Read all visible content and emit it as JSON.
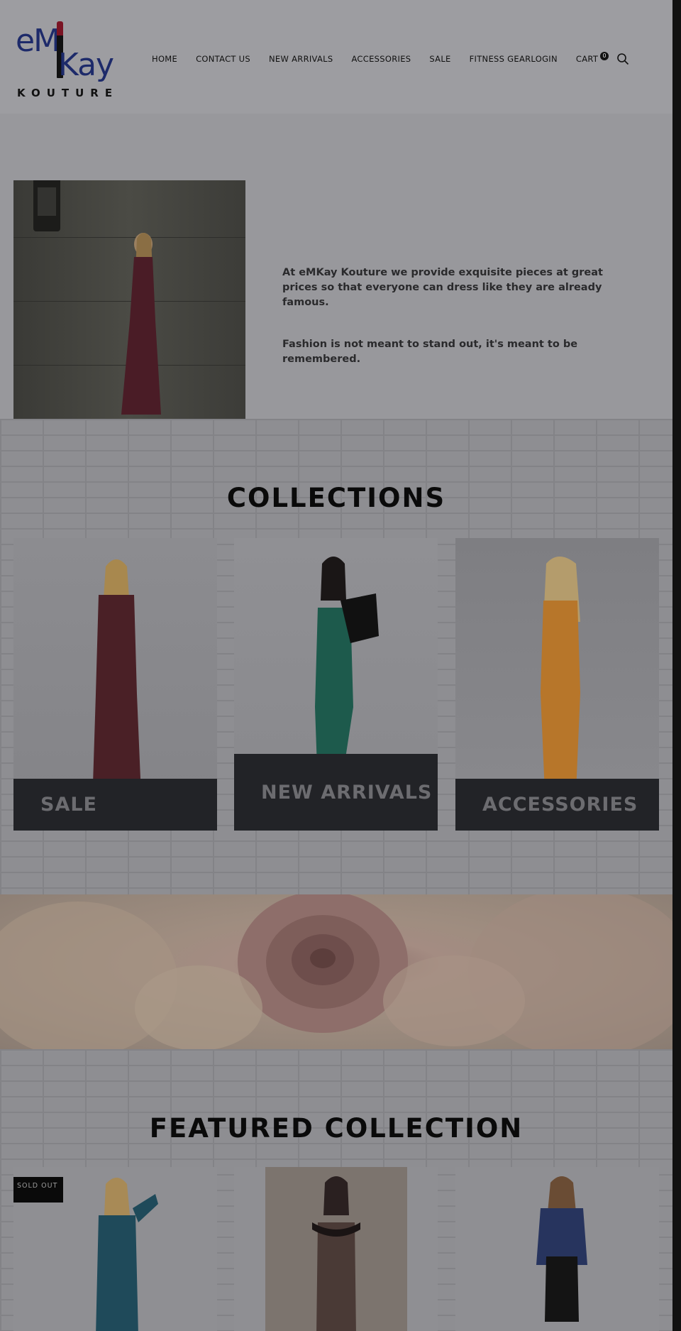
{
  "brand": {
    "logo_main_left": "eM",
    "logo_main_right": "Kay",
    "logo_sub": "KOUTURE"
  },
  "nav": {
    "items": [
      {
        "label": "HOME"
      },
      {
        "label": "CONTACT US"
      },
      {
        "label": "NEW ARRIVALS"
      },
      {
        "label": "ACCESSORIES"
      },
      {
        "label": "SALE"
      },
      {
        "label": "FITNESS GEARLOGIN"
      },
      {
        "label": "CART"
      }
    ],
    "cart_count": "0",
    "search_icon": "search-icon"
  },
  "intro": {
    "paragraph_1": "At eMKay Kouture we provide exquisite pieces at great prices so that everyone can dress like they are already famous.",
    "paragraph_2": "Fashion is not meant to stand out, it's meant to be remembered."
  },
  "collections": {
    "title": "COLLECTIONS",
    "cards": [
      {
        "label": "SALE",
        "dress_color": "#4a2026"
      },
      {
        "label": "NEW ARRIVALS",
        "dress_color": "#1d5a4c"
      },
      {
        "label": "ACCESSORIES",
        "dress_color": "#b7762a"
      }
    ]
  },
  "featured": {
    "title": "FEATURED COLLECTION",
    "sold_out_label": "SOLD OUT",
    "cards": [
      {
        "dress_color": "#1f4a5a"
      },
      {
        "dress_color": "#4a3a36"
      },
      {
        "dress_color": "#27345e"
      }
    ]
  }
}
